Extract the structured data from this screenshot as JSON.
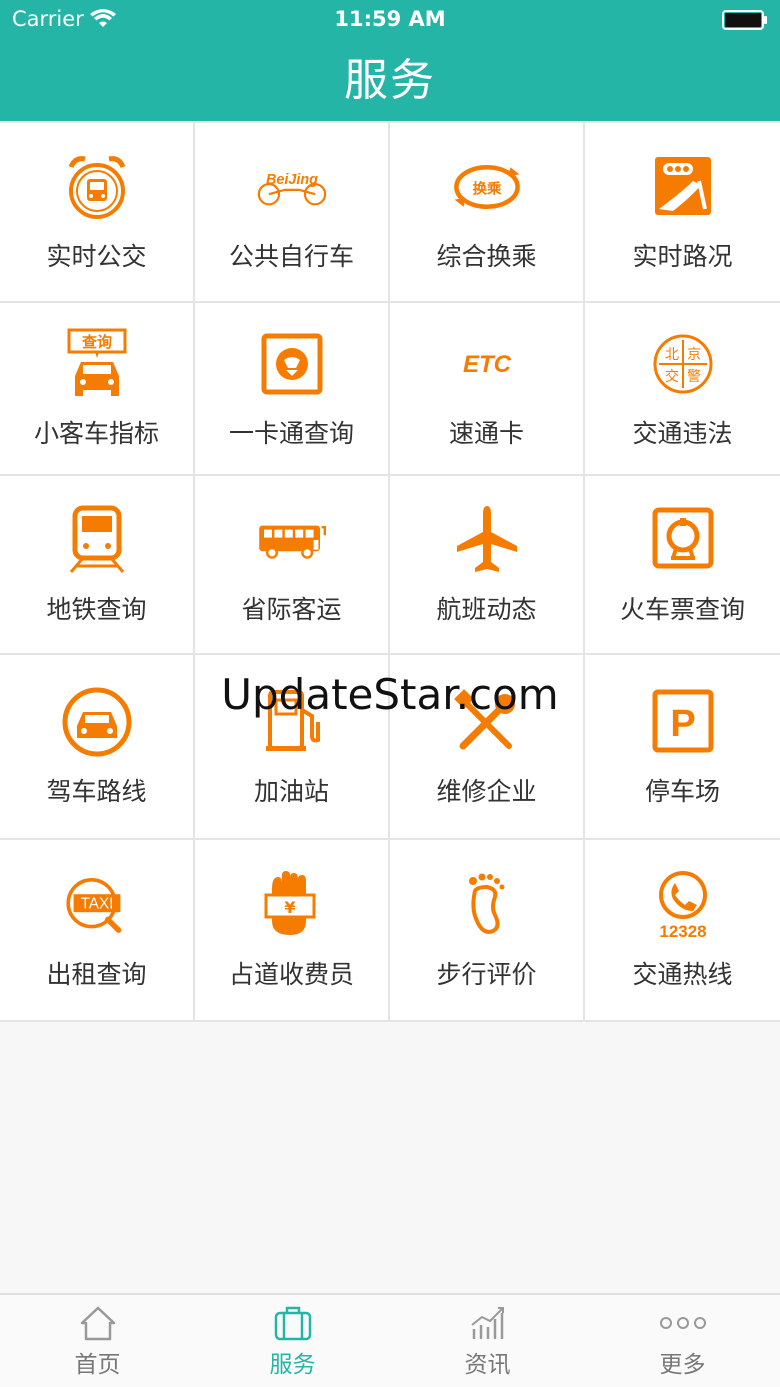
{
  "status": {
    "carrier": "Carrier",
    "time": "11:59 AM"
  },
  "header": {
    "title": "服务"
  },
  "colors": {
    "accent": "#25b5a7",
    "icon": "#f57c00",
    "tab_inactive": "#999999"
  },
  "services": [
    {
      "label": "实时公交",
      "icon": "alarm-bus-icon"
    },
    {
      "label": "公共自行车",
      "icon": "beijing-bike-icon",
      "icon_text": "BeiJing"
    },
    {
      "label": "综合换乘",
      "icon": "transfer-icon",
      "icon_text": "换乘"
    },
    {
      "label": "实时路况",
      "icon": "traffic-light-road-icon"
    },
    {
      "label": "小客车指标",
      "icon": "car-query-icon",
      "icon_text": "查询"
    },
    {
      "label": "一卡通查询",
      "icon": "transit-card-icon"
    },
    {
      "label": "速通卡",
      "icon": "etc-icon",
      "icon_text": "ETC"
    },
    {
      "label": "交通违法",
      "icon": "traffic-police-badge-icon",
      "icon_text": "北京交警"
    },
    {
      "label": "地铁查询",
      "icon": "subway-icon"
    },
    {
      "label": "省际客运",
      "icon": "coach-bus-icon"
    },
    {
      "label": "航班动态",
      "icon": "airplane-icon"
    },
    {
      "label": "火车票查询",
      "icon": "railway-icon"
    },
    {
      "label": "驾车路线",
      "icon": "car-circle-icon"
    },
    {
      "label": "加油站",
      "icon": "gas-station-icon"
    },
    {
      "label": "维修企业",
      "icon": "repair-tools-icon"
    },
    {
      "label": "停车场",
      "icon": "parking-icon",
      "icon_text": "P"
    },
    {
      "label": "出租查询",
      "icon": "taxi-search-icon",
      "icon_text": "TAXI"
    },
    {
      "label": "占道收费员",
      "icon": "toll-collector-icon",
      "icon_text": "¥"
    },
    {
      "label": "步行评价",
      "icon": "footprint-icon"
    },
    {
      "label": "交通热线",
      "icon": "hotline-phone-icon",
      "icon_text": "12328"
    }
  ],
  "watermark": "UpdateStar.com",
  "tabs": [
    {
      "label": "首页",
      "icon": "home-icon",
      "active": false
    },
    {
      "label": "服务",
      "icon": "briefcase-icon",
      "active": true
    },
    {
      "label": "资讯",
      "icon": "chart-icon",
      "active": false
    },
    {
      "label": "更多",
      "icon": "more-dots-icon",
      "active": false
    }
  ]
}
